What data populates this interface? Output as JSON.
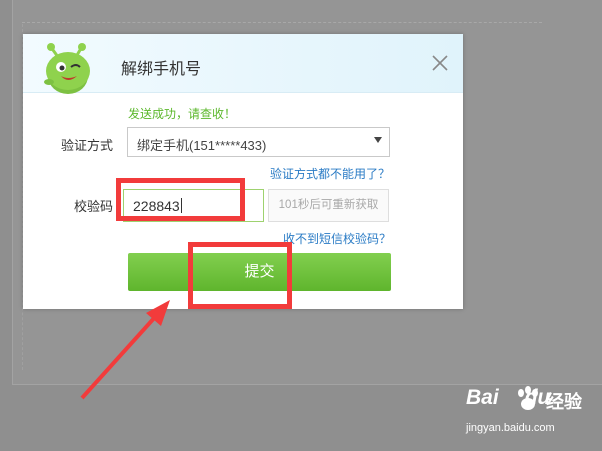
{
  "dialog": {
    "title": "解绑手机号",
    "success_message": "发送成功，请查收！",
    "method_label": "验证方式",
    "method_selected": "绑定手机(151*****433)",
    "method_unavailable_link": "验证方式都不能用了？",
    "code_label": "校验码",
    "code_value": "228843",
    "resend_label": "101秒后可重新获取",
    "no_sms_link": "收不到短信校验码？",
    "submit_label": "提交"
  },
  "watermark": {
    "logo": "Bai",
    "logo_suffix": "du",
    "product": "经验",
    "url": "jingyan.baidu.com"
  },
  "colors": {
    "success": "#5cb82c",
    "link": "#2a7bc5",
    "submit": "#6abf38",
    "annotation": "#f23b3b"
  }
}
